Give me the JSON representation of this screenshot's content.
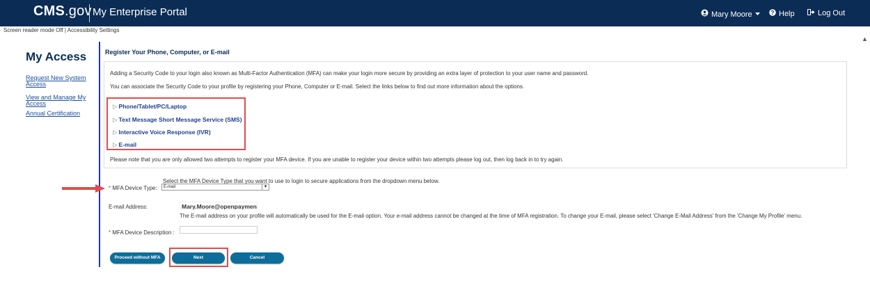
{
  "header": {
    "logo_bold": "CMS",
    "logo_rest": ".gov",
    "portal_title": "My Enterprise Portal",
    "user_name": "Mary Moore",
    "help": "Help",
    "logout": "Log Out"
  },
  "topnote": {
    "screen_reader": "Screen reader mode Off",
    "sep": "|",
    "accessibility": "Accessibility Settings"
  },
  "sidebar": {
    "title": "My Access",
    "items": [
      {
        "line1": "Request New System",
        "line2": "Access"
      },
      {
        "line1": "View and Manage My",
        "line2": "Access"
      },
      {
        "line1": "Annual Certification",
        "line2": ""
      }
    ]
  },
  "main": {
    "title": "Register Your Phone, Computer, or E-mail",
    "intro1": "Adding a Security Code to your login also known as Multi-Factor Authentication (MFA) can make your login more secure by providing an extra layer of protection to your user name and password.",
    "intro2": "You can associate the Security Code to your profile by registering your Phone, Computer or E-mail. Select the links below to find out more information about the options.",
    "options": [
      "Phone/Tablet/PC/Laptop",
      "Text Message Short Message Service (SMS)",
      "Interactive Voice Response (IVR)",
      "E-mail"
    ],
    "note": "Please note that you are only allowed two attempts to register your MFA device. If you are unable to register your device within two attempts please log out, then log back in to try again."
  },
  "form": {
    "select_hint": "Select the MFA Device Type that you want to use to login to secure applications from the dropdown menu below.",
    "required_mark": "*",
    "device_type_label": "MFA Device Type:",
    "device_type_value": "E-mail",
    "email_label": "E-mail Address:",
    "email_value": "Mary.Moore@openpayment",
    "email_note": "The E-mail address on your profile will automatically be used for the E-mail option. Your e-mail address cannot be changed at the time of MFA registration. To change your E-mail, please select 'Change E-Mail Address' from the 'Change My Profile' menu.",
    "description_label": "MFA Device Description :"
  },
  "buttons": {
    "proceed": "Proceed without MFA",
    "next": "Next",
    "cancel": "Cancel"
  },
  "colors": {
    "header_bg": "#0b2d55",
    "button_bg": "#0e6d9a",
    "highlight": "#e24b4b",
    "divider": "#1f34b9"
  }
}
